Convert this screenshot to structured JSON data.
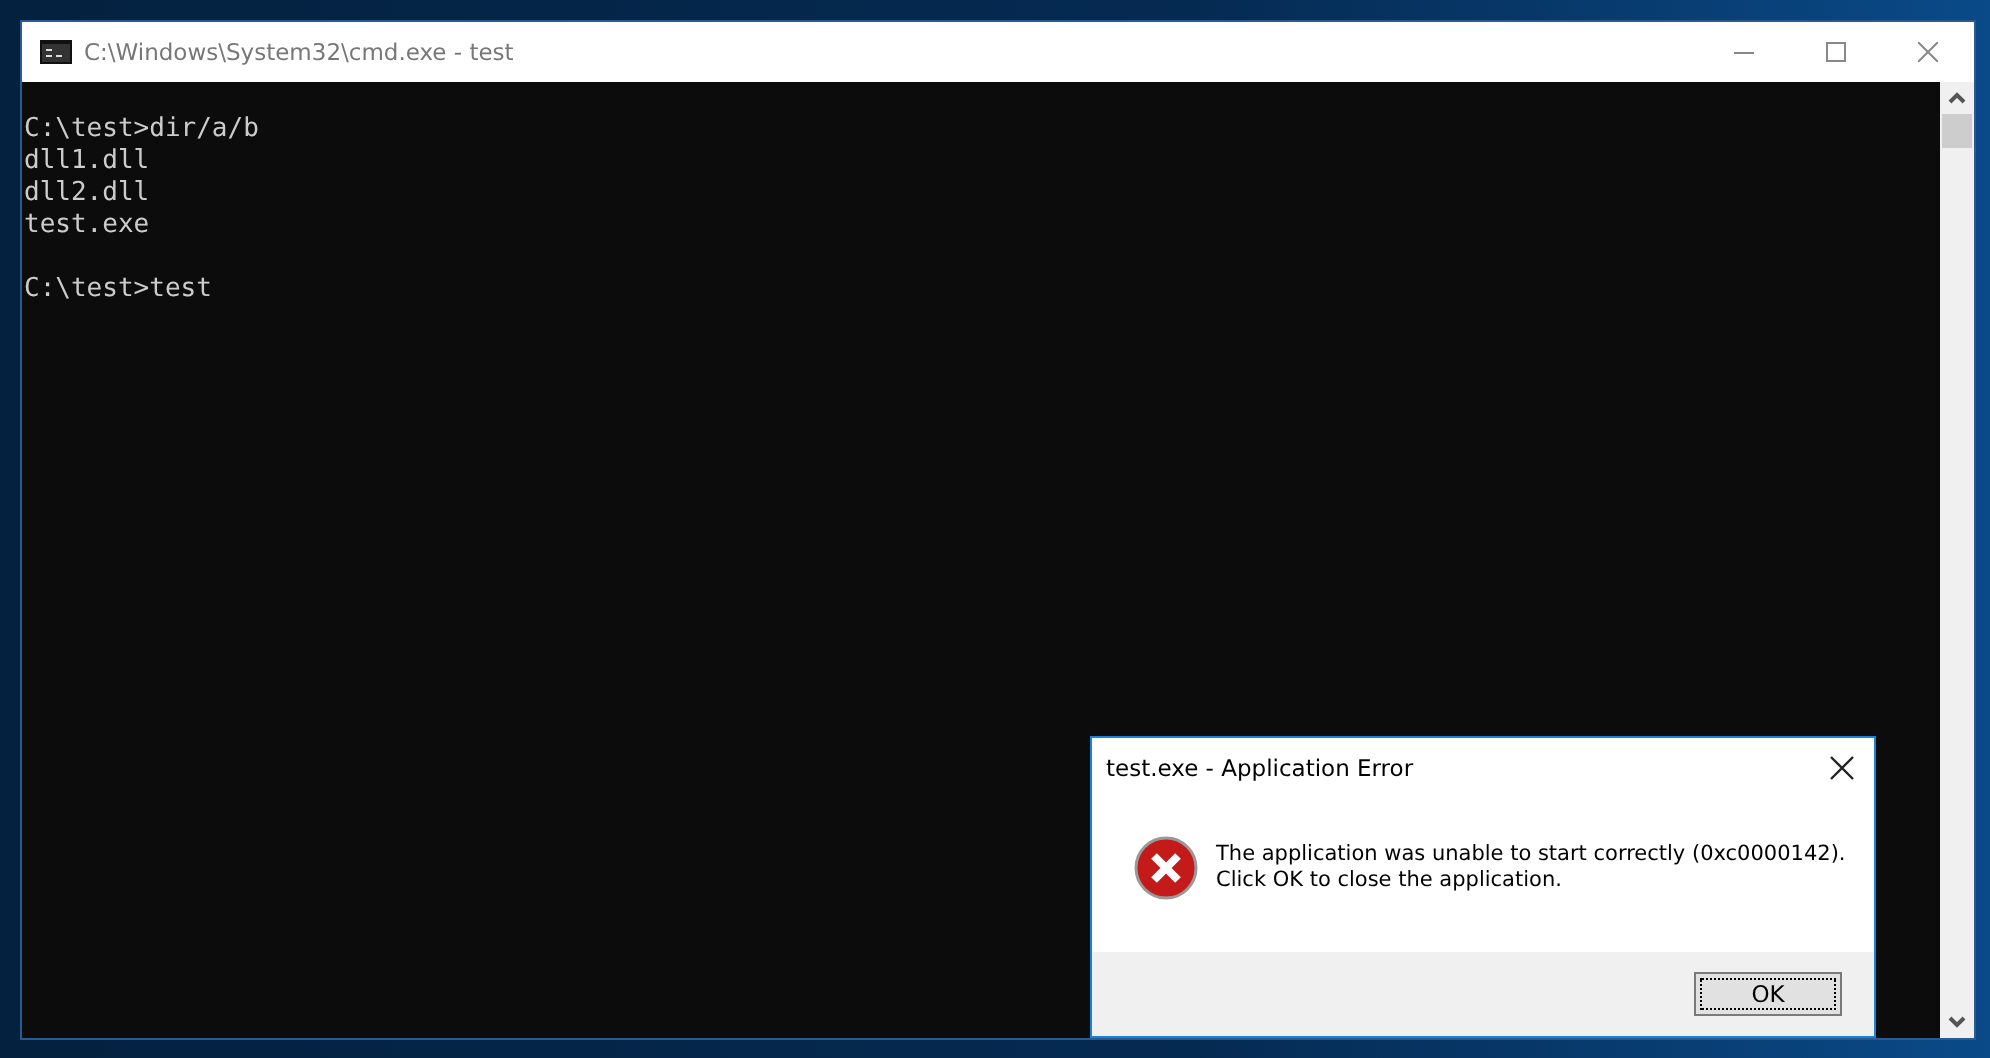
{
  "window": {
    "title": "C:\\Windows\\System32\\cmd.exe - test"
  },
  "console": {
    "blocks": [
      [
        "C:\\test>dir/a/b",
        "dll1.dll",
        "dll2.dll",
        "test.exe"
      ],
      [
        "C:\\test>test"
      ]
    ]
  },
  "dialog": {
    "title": "test.exe - Application Error",
    "message": [
      "The application was unable to start correctly (0xc0000142).",
      "Click OK to close the application."
    ],
    "buttons": [
      "OK"
    ]
  }
}
